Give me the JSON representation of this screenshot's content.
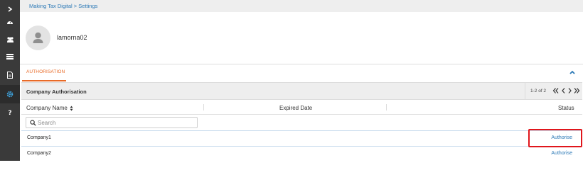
{
  "sidebar": {
    "items": [
      {
        "icon": "chevron-right-icon"
      },
      {
        "icon": "dashboard-icon"
      },
      {
        "icon": "users-icon"
      },
      {
        "icon": "list-icon"
      },
      {
        "icon": "document-icon"
      },
      {
        "icon": "gear-icon",
        "active": true
      },
      {
        "icon": "help-icon"
      }
    ]
  },
  "breadcrumb": {
    "text": "Making Tax Digital > Settings"
  },
  "profile": {
    "username": "lamorna02"
  },
  "tabs": [
    {
      "label": "AUTHORISATION",
      "active": true
    }
  ],
  "panel": {
    "title": "Company Authorisation",
    "pager": {
      "count": "1-2 of 2"
    }
  },
  "table": {
    "columns": [
      "Company Name",
      "Expired Date",
      "Status"
    ],
    "search_placeholder": "Search",
    "rows": [
      {
        "company": "Company1",
        "expired": "",
        "status": "Authorise"
      },
      {
        "company": "Company2",
        "expired": "",
        "status": "Authorise"
      }
    ]
  },
  "colors": {
    "accent": "#e86a27",
    "link": "#2a78b6",
    "sidebar": "#3a3a3a",
    "highlight": "#e0161c"
  }
}
